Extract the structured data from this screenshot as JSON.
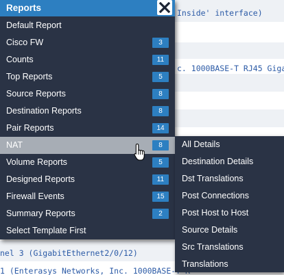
{
  "background": {
    "lines": [
      "Inside' interface)",
      "c. 1000BASE-T RJ45 Gigab",
      "nel 3 (GigabitEthernet2/0/12)",
      "1 (Enterasys Networks, Inc. 1000BASE-T R"
    ]
  },
  "menu": {
    "title": "Reports",
    "close_icon": "close-icon",
    "active_index": 8,
    "items": [
      {
        "label": "Default Report",
        "count": ""
      },
      {
        "label": "Cisco FW",
        "count": "3"
      },
      {
        "label": "Counts",
        "count": "11"
      },
      {
        "label": "Top Reports",
        "count": "5"
      },
      {
        "label": "Source Reports",
        "count": "8"
      },
      {
        "label": "Destination Reports",
        "count": "8"
      },
      {
        "label": "Pair Reports",
        "count": "14"
      },
      {
        "label": "NAT",
        "count": "8"
      },
      {
        "label": "Volume Reports",
        "count": "5"
      },
      {
        "label": "Designed Reports",
        "count": "11"
      },
      {
        "label": "Firewall Events",
        "count": "15"
      },
      {
        "label": "Summary Reports",
        "count": "2"
      },
      {
        "label": "Select Template First",
        "count": ""
      }
    ]
  },
  "submenu": {
    "items": [
      "All Details",
      "Destination Details",
      "Dst Translations",
      "Post Connections",
      "Post Host to Host",
      "Source Details",
      "Src Translations",
      "Translations"
    ]
  },
  "colors": {
    "menu_bg": "#2a3345",
    "header_bg": "#2d7fc1",
    "badge_bg": "#2d7fc1",
    "active_bg": "#a7adb5",
    "link_text": "#2b5aa6"
  },
  "cursor": "hand-pointer-icon"
}
